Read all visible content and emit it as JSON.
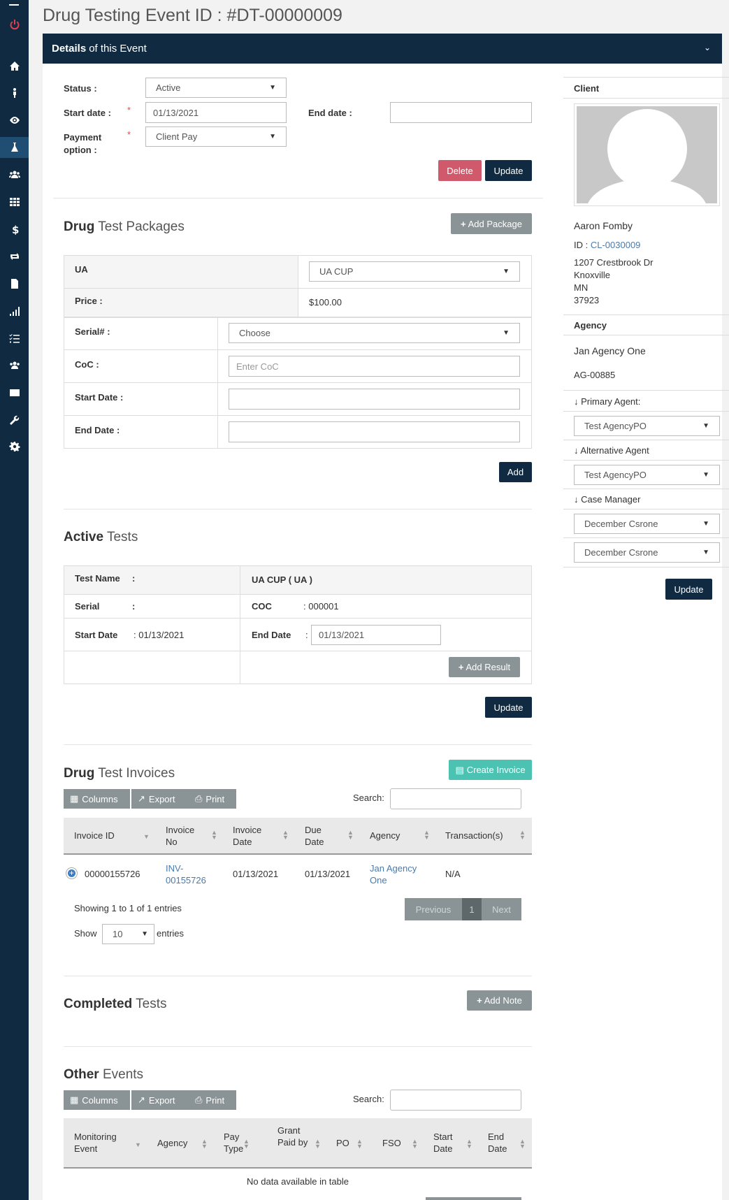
{
  "page": {
    "title": "Drug Testing Event ID : #DT-00000009"
  },
  "details_bar": {
    "bold": "Details",
    "rest": "of this Event"
  },
  "form": {
    "status_label": "Status :",
    "status_value": "Active",
    "start_label": "Start date :",
    "start_value": "01/13/2021",
    "end_label": "End date :",
    "end_value": "",
    "payment_label": "Payment option :",
    "payment_value": "Client Pay",
    "delete_label": "Delete",
    "update_label": "Update"
  },
  "packages": {
    "title_bold": "Drug",
    "title_rest": "Test Packages",
    "add_label": "Add Package",
    "ua_label": "UA",
    "ua_value": "UA CUP",
    "price_label": "Price :",
    "price_value": "$100.00",
    "serial_label": "Serial# :",
    "serial_value": "Choose",
    "coc_label": "CoC :",
    "coc_placeholder": "Enter CoC",
    "start_label": "Start Date :",
    "end_label": "End Date :",
    "add_button": "Add"
  },
  "active": {
    "title_bold": "Active",
    "title_rest": "Tests",
    "test_name_label": "Test Name",
    "test_name_value": "UA CUP ( UA )",
    "serial_label": "Serial",
    "serial_value": "",
    "coc_label": "COC",
    "coc_value": "000001",
    "start_label": "Start Date",
    "start_value": "01/13/2021",
    "end_label": "End Date",
    "end_value": "01/13/2021",
    "add_result": "Add Result",
    "update": "Update"
  },
  "invoices": {
    "title_bold": "Drug",
    "title_rest": "Test Invoices",
    "create": "Create Invoice",
    "columns": "Columns",
    "export": "Export",
    "print": "Print",
    "search_label": "Search:",
    "headers": [
      "Invoice ID",
      "Invoice No",
      "Invoice Date",
      "Due Date",
      "Agency",
      "Transaction(s)"
    ],
    "row": {
      "id": "00000155726",
      "no": "INV-00155726",
      "date": "01/13/2021",
      "due": "01/13/2021",
      "agency": "Jan Agency One",
      "tx": "N/A"
    },
    "info": "Showing 1 to 1 of 1 entries",
    "prev": "Previous",
    "page": "1",
    "next": "Next",
    "show": "Show",
    "show_value": "10",
    "entries": "entries"
  },
  "completed": {
    "title_bold": "Completed",
    "title_rest": "Tests",
    "add_note": "Add Note"
  },
  "other": {
    "title_bold": "Other",
    "title_rest": "Events",
    "columns": "Columns",
    "export": "Export",
    "print": "Print",
    "search_label": "Search:",
    "headers": [
      "Monitoring Event",
      "Agency",
      "Pay Type",
      "Grant Paid by",
      "PO",
      "FSO",
      "Start Date",
      "End Date"
    ],
    "empty": "No data available in table"
  },
  "client": {
    "title": "Client",
    "name": "Aaron Fomby",
    "id_label": "ID :",
    "id_value": "CL-0030009",
    "address": [
      "1207 Crestbrook Dr",
      "Knoxville",
      "MN",
      "37923"
    ]
  },
  "agency": {
    "title": "Agency",
    "name": "Jan Agency One",
    "code": "AG-00885",
    "primary_label": "Primary Agent:",
    "primary_value": "Test AgencyPO",
    "alt_label": "Alternative Agent",
    "alt_value": "Test AgencyPO",
    "case_label": "Case Manager",
    "case_value1": "December Csrone",
    "case_value2": "December Csrone",
    "update": "Update"
  },
  "colors": {
    "navy": "#0f2a41",
    "red": "#d05a6b",
    "gray": "#8a9497",
    "teal": "#4cc3b2",
    "link": "#4a7bab"
  }
}
